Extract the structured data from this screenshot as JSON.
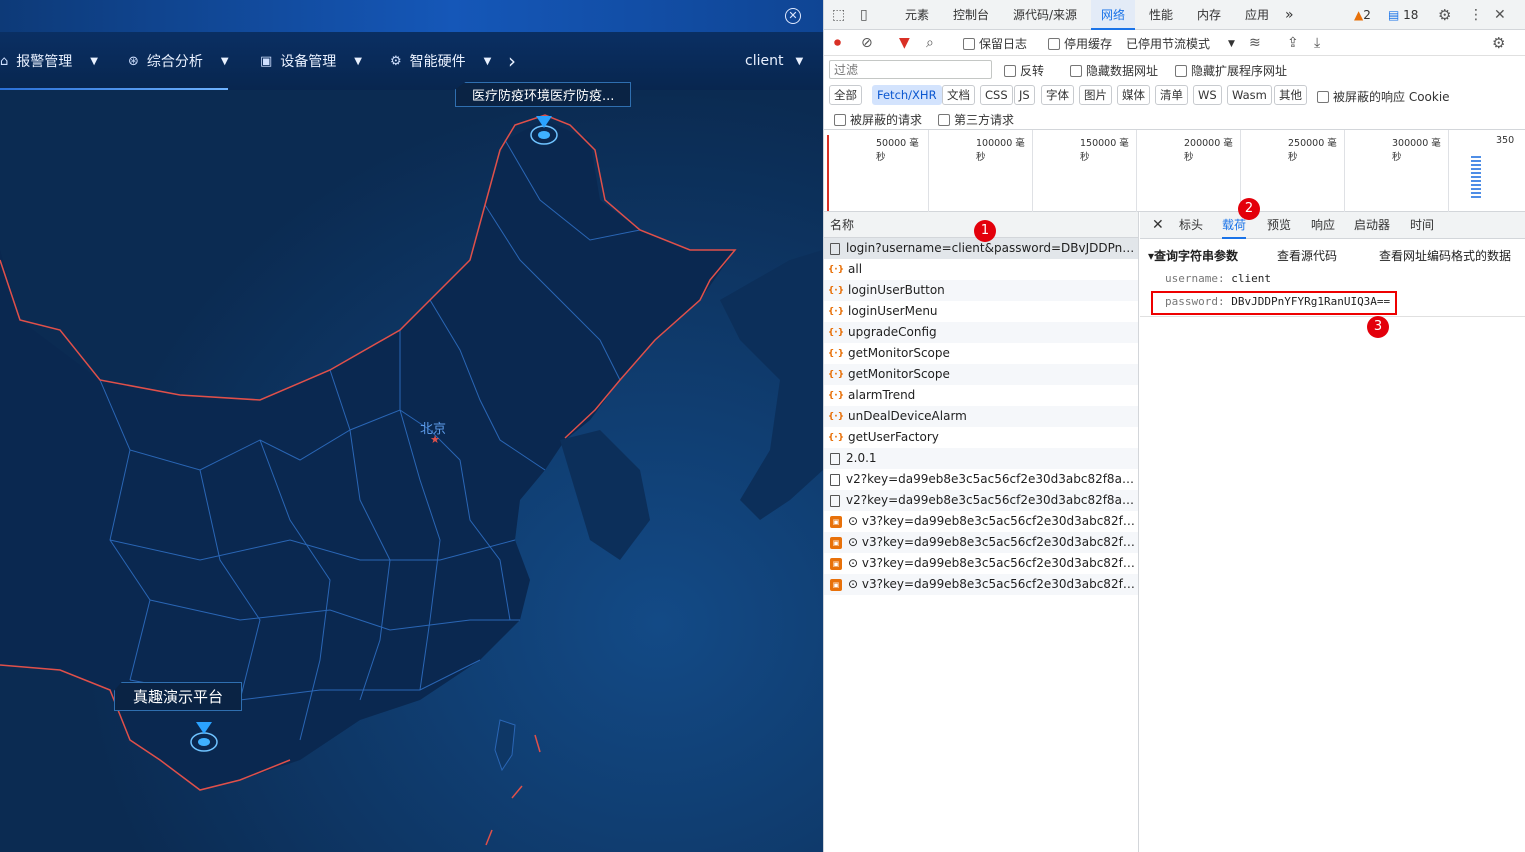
{
  "app": {
    "close_glyph": "✕",
    "nav": [
      {
        "label": "报警管理",
        "icon": "home-icon"
      },
      {
        "label": "综合分析",
        "icon": "search-analytics-icon"
      },
      {
        "label": "设备管理",
        "icon": "device-icon"
      },
      {
        "label": "智能硬件",
        "icon": "chip-icon"
      }
    ],
    "nav_more_glyph": "›",
    "user": "client",
    "map": {
      "capital_label": "北京",
      "marker_top_label": "医疗防疫环境医疗防疫...",
      "marker_bottom_label": "真趣演示平台"
    },
    "colors": {
      "bg": "#0b2b52",
      "border": "#e0504a",
      "province": "#2a66b5",
      "accent": "#1a73e8"
    }
  },
  "devtools": {
    "main_tabs": [
      "元素",
      "控制台",
      "源代码/来源",
      "网络",
      "性能",
      "内存",
      "应用"
    ],
    "active_tab": "网络",
    "more_tabs_glyph": "»",
    "warnings_count": "2",
    "messages_count": "18",
    "toolbar": {
      "preserve_log": "保留日志",
      "disable_cache": "停用缓存",
      "throttle": "已停用节流模式"
    },
    "filter": {
      "placeholder": "过滤",
      "invert": "反转",
      "hide_data_urls": "隐藏数据网址",
      "hide_extension_urls": "隐藏扩展程序网址"
    },
    "types": [
      "全部",
      "Fetch/XHR",
      "文档",
      "CSS",
      "JS",
      "字体",
      "图片",
      "媒体",
      "清单",
      "WS",
      "Wasm",
      "其他"
    ],
    "active_type": "Fetch/XHR",
    "blocked_cookies": "被屏蔽的响应 Cookie",
    "blocked_requests": "被屏蔽的请求",
    "third_party": "第三方请求",
    "timeline_labels": [
      "50000 毫秒",
      "100000 毫秒",
      "150000 毫秒",
      "200000 毫秒",
      "250000 毫秒",
      "300000 毫秒",
      "350"
    ],
    "requests_header": "名称",
    "requests": [
      {
        "name": "login?username=client&password=DBvJDDPnYFYRg...",
        "type": "doc"
      },
      {
        "name": "all",
        "type": "fetch"
      },
      {
        "name": "loginUserButton",
        "type": "fetch"
      },
      {
        "name": "loginUserMenu",
        "type": "fetch"
      },
      {
        "name": "upgradeConfig",
        "type": "fetch"
      },
      {
        "name": "getMonitorScope",
        "type": "fetch"
      },
      {
        "name": "getMonitorScope",
        "type": "fetch"
      },
      {
        "name": "alarmTrend",
        "type": "fetch"
      },
      {
        "name": "unDealDeviceAlarm",
        "type": "fetch"
      },
      {
        "name": "getUserFactory",
        "type": "fetch"
      },
      {
        "name": "2.0.1",
        "type": "doc"
      },
      {
        "name": "v2?key=da99eb8e3c5ac56cf2e30d3abc82f8a2&flds...",
        "type": "doc"
      },
      {
        "name": "v2?key=da99eb8e3c5ac56cf2e30d3abc82f8a2&flds...",
        "type": "doc"
      },
      {
        "name": "⊙ v3?key=da99eb8e3c5ac56cf2e30d3abc82f8a2&va...",
        "type": "img"
      },
      {
        "name": "⊙ v3?key=da99eb8e3c5ac56cf2e30d3abc82f8a2&va...",
        "type": "img"
      },
      {
        "name": "⊙ v3?key=da99eb8e3c5ac56cf2e30d3abc82f8a2&va...",
        "type": "img"
      },
      {
        "name": "⊙ v3?key=da99eb8e3c5ac56cf2e30d3abc82f8a2&va...",
        "type": "img"
      }
    ],
    "detail_tabs": [
      "标头",
      "载荷",
      "预览",
      "响应",
      "启动器",
      "时间"
    ],
    "active_detail_tab": "载荷",
    "payload": {
      "section_title": "▾查询字符串参数",
      "view_source": "查看源代码",
      "view_url_encoded": "查看网址编码格式的数据",
      "params": [
        {
          "key": "username:",
          "value": "client"
        },
        {
          "key": "password:",
          "value": "DBvJDDPnYFYRg1RanUIQ3A=="
        }
      ]
    },
    "annotations": [
      "1",
      "2",
      "3"
    ]
  }
}
